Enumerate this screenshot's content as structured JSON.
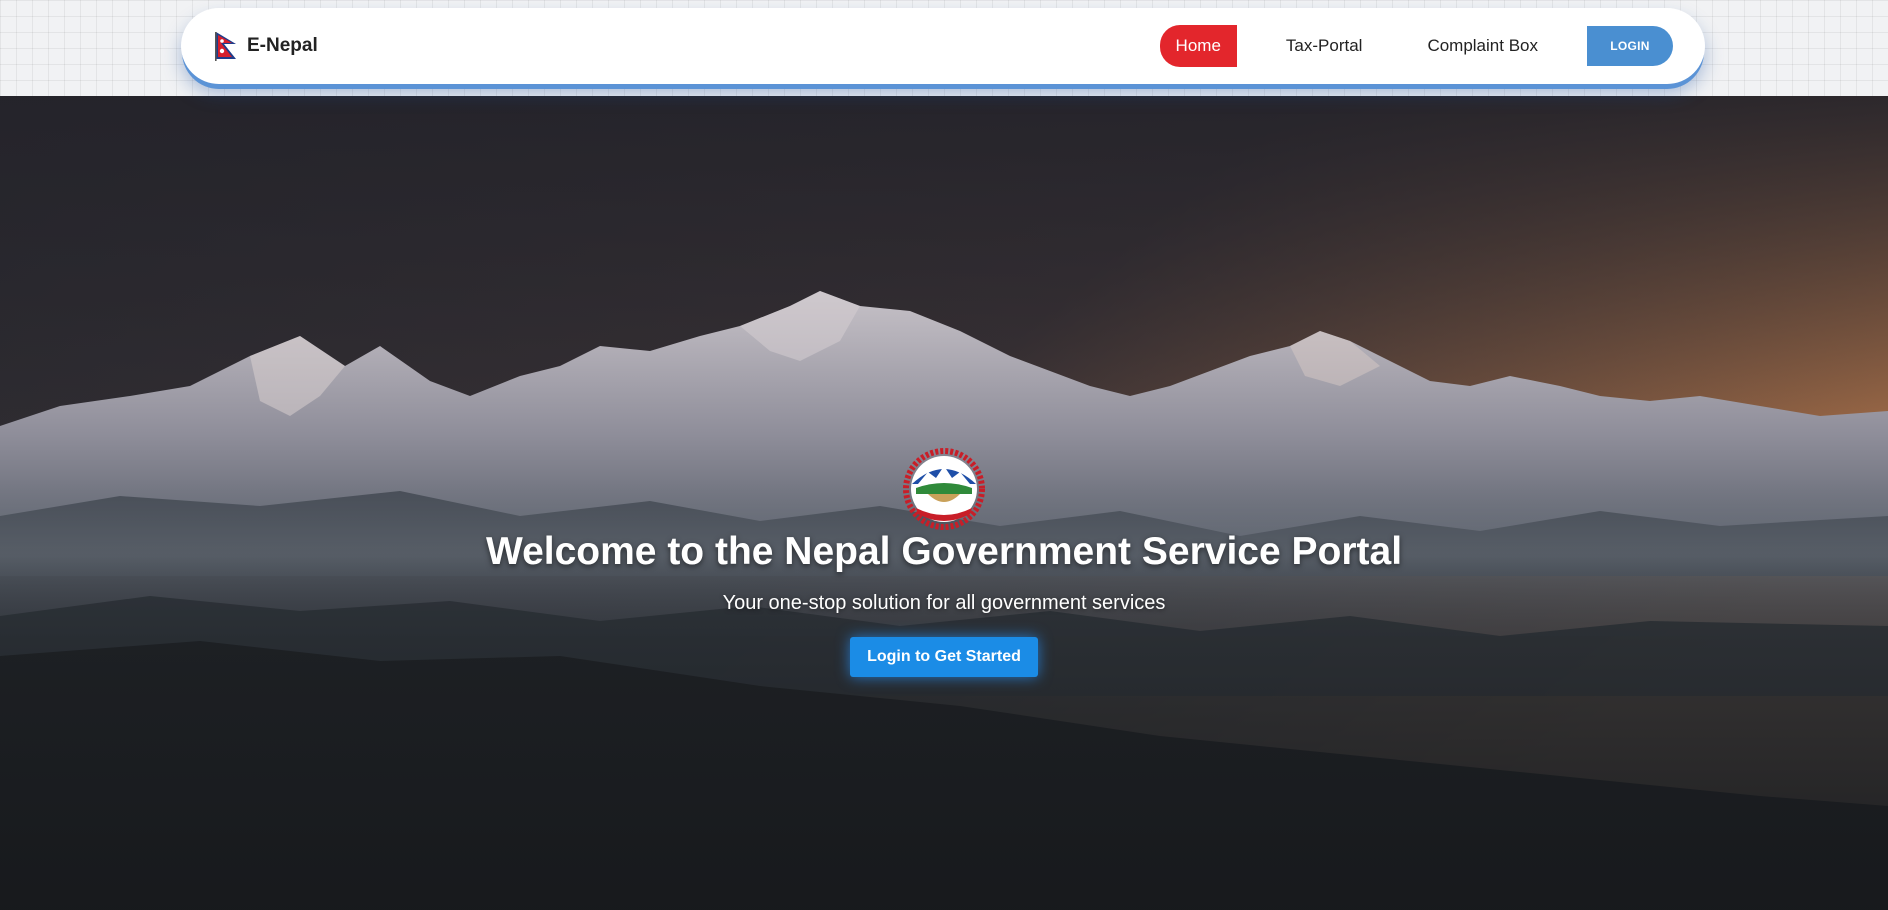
{
  "navbar": {
    "brand_name": "E-Nepal",
    "brand_icon": "nepal-flag-icon",
    "links": {
      "home": "Home",
      "tax_portal": "Tax-Portal",
      "complaint_box": "Complaint Box"
    },
    "login_label": "LOGIN"
  },
  "hero": {
    "emblem": "nepal-emblem-icon",
    "title": "Welcome to the Nepal Government Service Portal",
    "subtitle": "Your one-stop solution for all government services",
    "cta_label": "Login to Get Started"
  },
  "colors": {
    "nav_active": "#e3262c",
    "login_button": "#4a8fd1",
    "cta_button": "#1b8ce6",
    "navbar_shadow": "#5b93d6"
  }
}
